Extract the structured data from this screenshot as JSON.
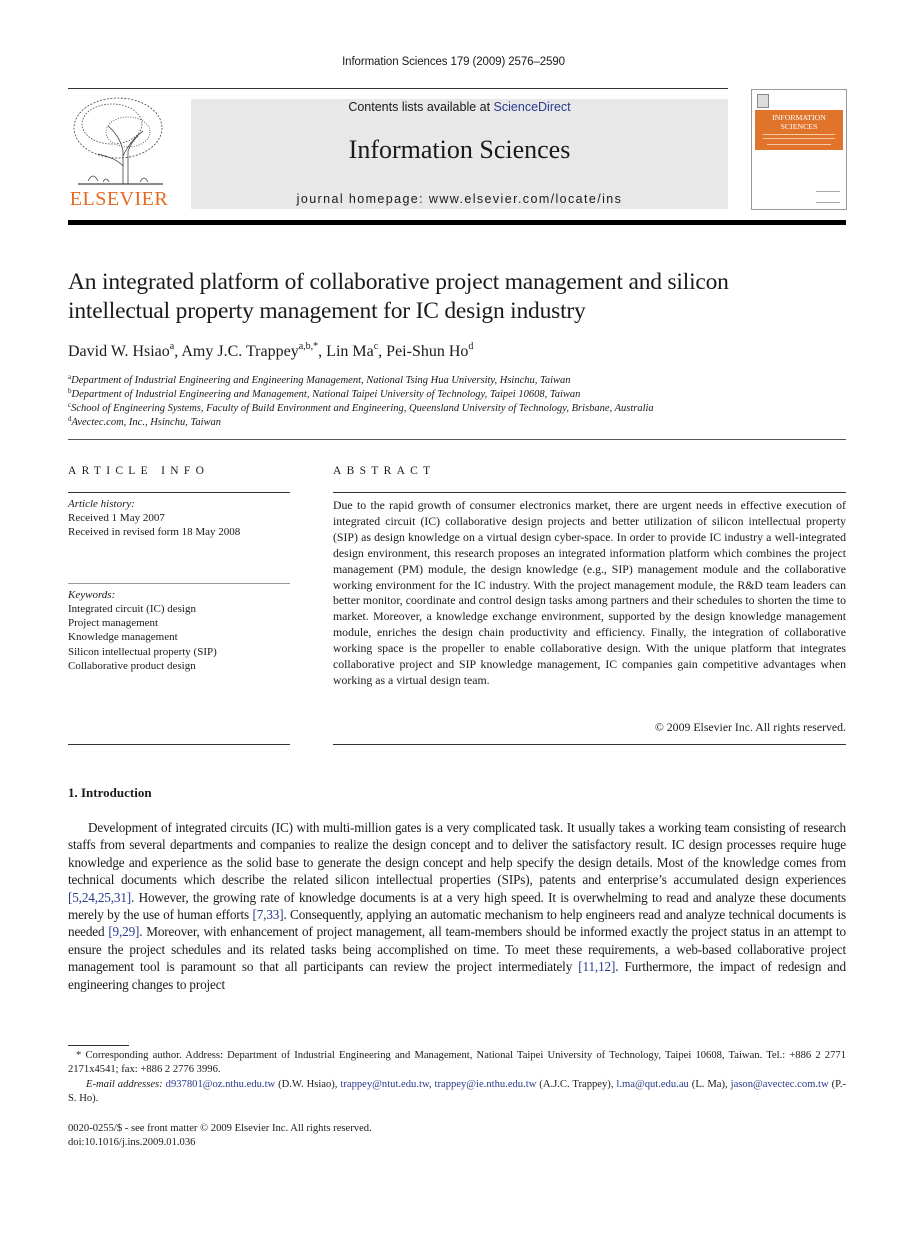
{
  "running_head": "Information Sciences 179 (2009) 2576–2590",
  "masthead": {
    "contents_prefix": "Contents lists available at ",
    "contents_link": "ScienceDirect",
    "journal_title": "Information Sciences",
    "homepage": "journal homepage: www.elsevier.com/locate/ins",
    "publisher_logo_text": "ELSEVIER",
    "cover": {
      "title_line1": "INFORMATION",
      "title_line2": "SCIENCES",
      "brand_color": "#e0742a"
    },
    "accent_color": "#e56a1f"
  },
  "article": {
    "title": "An integrated platform of collaborative project management and silicon intellectual property management for IC design industry",
    "authors": [
      {
        "name": "David W. Hsiao",
        "sup": "a",
        "sep": ", "
      },
      {
        "name": "Amy J.C. Trappey",
        "sup": "a,b,*",
        "sep": ", "
      },
      {
        "name": "Lin Ma",
        "sup": "c",
        "sep": ", "
      },
      {
        "name": "Pei-Shun Ho",
        "sup": "d",
        "sep": ""
      }
    ],
    "affiliations": [
      {
        "mark": "a",
        "text": "Department of Industrial Engineering and Engineering Management, National Tsing Hua University, Hsinchu, Taiwan"
      },
      {
        "mark": "b",
        "text": "Department of Industrial Engineering and Management, National Taipei University of Technology, Taipei 10608, Taiwan"
      },
      {
        "mark": "c",
        "text": "School of Engineering Systems, Faculty of Build Environment and Engineering, Queensland University of Technology, Brisbane, Australia"
      },
      {
        "mark": "d",
        "text": "Avectec.com, Inc., Hsinchu, Taiwan"
      }
    ]
  },
  "article_info": {
    "heading": "ARTICLE INFO",
    "history_label": "Article history:",
    "history": [
      "Received 1 May 2007",
      "Received in revised form 18 May 2008"
    ],
    "keywords_label": "Keywords:",
    "keywords": [
      "Integrated circuit (IC) design",
      "Project management",
      "Knowledge management",
      "Silicon intellectual property (SIP)",
      "Collaborative product design"
    ]
  },
  "abstract": {
    "heading": "ABSTRACT",
    "text": "Due to the rapid growth of consumer electronics market, there are urgent needs in effective execution of integrated circuit (IC) collaborative design projects and better utilization of silicon intellectual property (SIP) as design knowledge on a virtual design cyber-space. In order to provide IC industry a well-integrated design environment, this research proposes an integrated information platform which combines the project management (PM) mod­ule, the design knowledge (e.g., SIP) management module and the collaborative working environment for the IC industry. With the project management module, the R&D team leaders can better monitor, coordinate and control design tasks among partners and their schedules to shorten the time to market. Moreover, a knowledge exchange environment, supported by the design knowledge management module, enriches the design chain pro­ductivity and efficiency. Finally, the integration of collaborative working space is the pro­peller to enable collaborative design. With the unique platform that integrates collaborative project and SIP knowledge management, IC companies gain competitive advantages when working as a virtual design team.",
    "copyright": "© 2009 Elsevier Inc. All rights reserved."
  },
  "introduction": {
    "heading": "1. Introduction",
    "segments": [
      {
        "t": "Development of integrated circuits (IC) with multi-million gates is a very complicated task. It usually takes a working team consisting of research staffs from several departments and companies to realize the design concept and to deliver the satisfactory result. IC design processes require huge knowledge and experience as the solid base to generate the design concept and help specify the design details. Most of the knowledge comes from technical documents which describe the re­lated silicon intellectual properties (SIPs), patents and enterprise’s accumulated design experiences ",
        "link": false
      },
      {
        "t": "[5,24,25,31]",
        "link": true
      },
      {
        "t": ". However, the growing rate of knowledge documents is at a very high speed. It is overwhelming to read and analyze these documents merely by the use of human efforts ",
        "link": false
      },
      {
        "t": "[7,33]",
        "link": true
      },
      {
        "t": ". Consequently, applying an automatic mechanism to help engineers read and ana­lyze technical documents is needed ",
        "link": false
      },
      {
        "t": "[9,29]",
        "link": true
      },
      {
        "t": ". Moreover, with enhancement of project management, all team-members should be informed exactly the project status in an attempt to ensure the project schedules and its related tasks being accomplished on time. To meet these requirements, a web-based collaborative project management tool is paramount so that all partic­ipants can review the project intermediately ",
        "link": false
      },
      {
        "t": "[11,12]",
        "link": true
      },
      {
        "t": ". Furthermore, the impact of redesign and engineering changes to project",
        "link": false
      }
    ]
  },
  "footnote": {
    "corresponding": "* Corresponding author. Address: Department of Industrial Engineering and Management, National Taipei University of Technology, Taipei 10608, Taiwan. Tel.: +886 2 2771 2171x4541; fax: +886 2 2776 3996.",
    "email_label": "E-mail addresses:",
    "emails": [
      {
        "addr": "d937801@oz.nthu.edu.tw",
        "who": " (D.W. Hsiao), "
      },
      {
        "addr": "trappey@ntut.edu.tw",
        "who": ", "
      },
      {
        "addr": "trappey@ie.nthu.edu.tw",
        "who": " (A.J.C. Trappey), "
      },
      {
        "addr": "l.ma@qut.edu.au",
        "who": " (L. Ma), "
      },
      {
        "addr": "jason@avectec.com.tw",
        "who": " (P.-S. Ho)."
      }
    ],
    "issn": "0020-0255/$ - see front matter © 2009 Elsevier Inc. All rights reserved.",
    "doi": "doi:10.1016/j.ins.2009.01.036"
  }
}
